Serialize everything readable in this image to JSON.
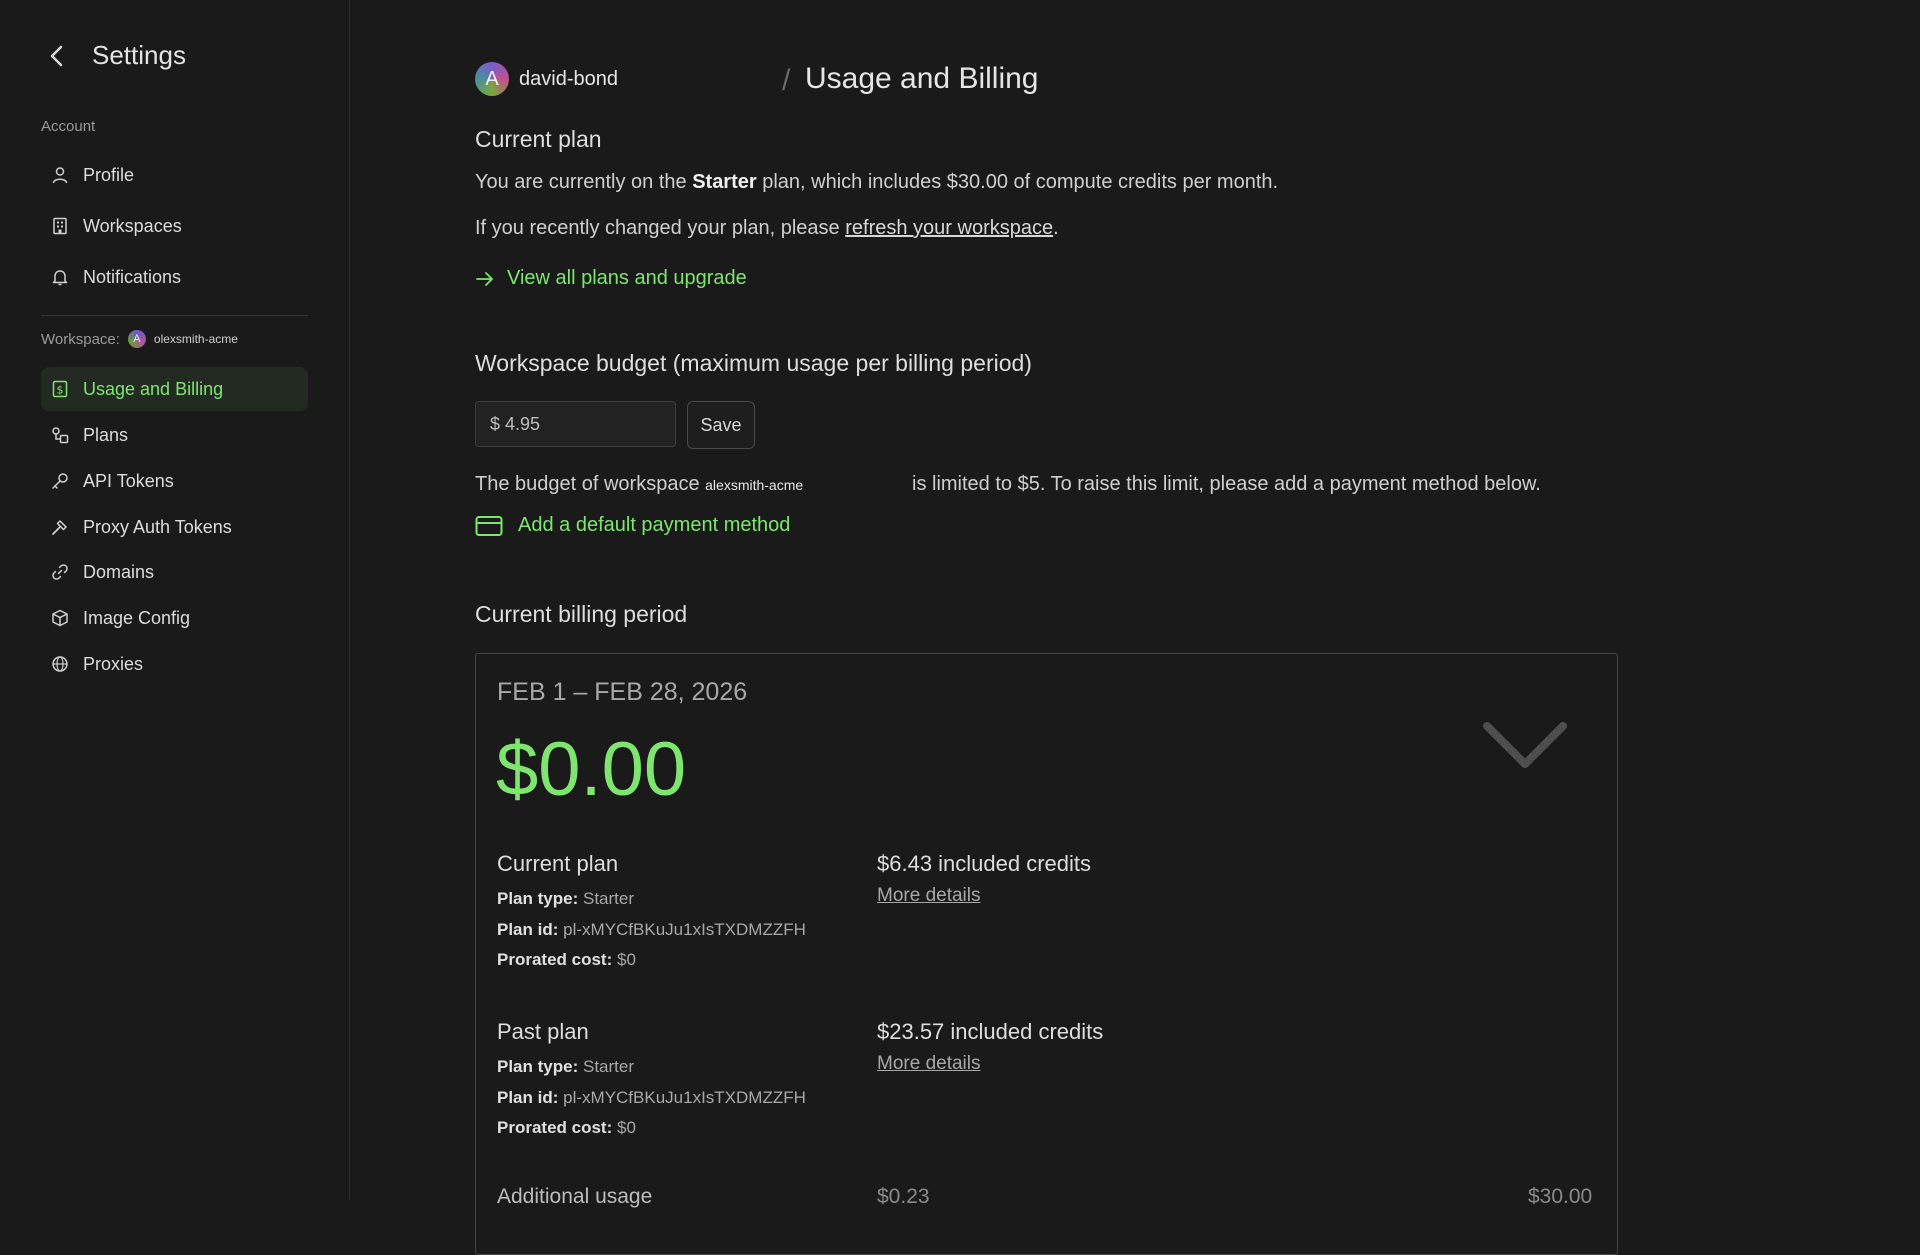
{
  "sidebar": {
    "title": "Settings",
    "account_label": "Account",
    "account_items": [
      {
        "label": "Profile"
      },
      {
        "label": "Workspaces"
      },
      {
        "label": "Notifications"
      }
    ],
    "workspace_label": "Workspace:",
    "workspace_avatar": "A",
    "workspace_name": "olexsmith-acme",
    "workspace_items": [
      {
        "label": "Usage and Billing"
      },
      {
        "label": "Plans"
      },
      {
        "label": "API Tokens"
      },
      {
        "label": "Proxy Auth Tokens"
      },
      {
        "label": "Domains"
      },
      {
        "label": "Image Config"
      },
      {
        "label": "Proxies"
      }
    ]
  },
  "header": {
    "avatar_letter": "A",
    "user": "david-bond",
    "separator": "/",
    "title": "Usage and Billing"
  },
  "current_plan": {
    "heading": "Current plan",
    "line1_pre": "You are currently on the ",
    "line1_plan": "Starter",
    "line1_post": " plan, which includes $30.00 of compute credits per month.",
    "line2_pre": "If you recently changed your plan, please ",
    "line2_link": "refresh your workspace",
    "line2_post": ".",
    "upgrade_link": "View all plans and upgrade"
  },
  "budget": {
    "heading": "Workspace budget (maximum usage per billing period)",
    "input_value": "$ 4.95",
    "save_label": "Save",
    "note_pre": "The budget of workspace ",
    "note_workspace": "alexsmith-acme",
    "note_post": "is limited to $5. To raise this limit, please add a payment method below.",
    "payment_link": "Add a default payment method"
  },
  "billing": {
    "heading": "Current billing period",
    "period": "FEB 1 – FEB 28, 2026",
    "amount": "$0.00",
    "current_plan": {
      "title": "Current plan",
      "plan_type_label": "Plan type:",
      "plan_type": "Starter",
      "plan_id_label": "Plan id:",
      "plan_id": "pl-xMYCfBKuJu1xIsTXDMZZFH",
      "prorated_label": "Prorated cost:",
      "prorated": "$0",
      "credits": "$6.43 included credits",
      "more": "More details"
    },
    "past_plan": {
      "title": "Past plan",
      "plan_type_label": "Plan type:",
      "plan_type": "Starter",
      "plan_id_label": "Plan id:",
      "plan_id": "pl-xMYCfBKuJu1xIsTXDMZZFH",
      "prorated_label": "Prorated cost:",
      "prorated": "$0",
      "credits": "$23.57 included credits",
      "more": "More details"
    },
    "additional": {
      "title": "Additional usage",
      "mid": "$0.23",
      "right": "$30.00"
    }
  },
  "colors": {
    "accent": "#7ee66f",
    "background": "#1a1a1a",
    "active_bg": "#222a22"
  }
}
